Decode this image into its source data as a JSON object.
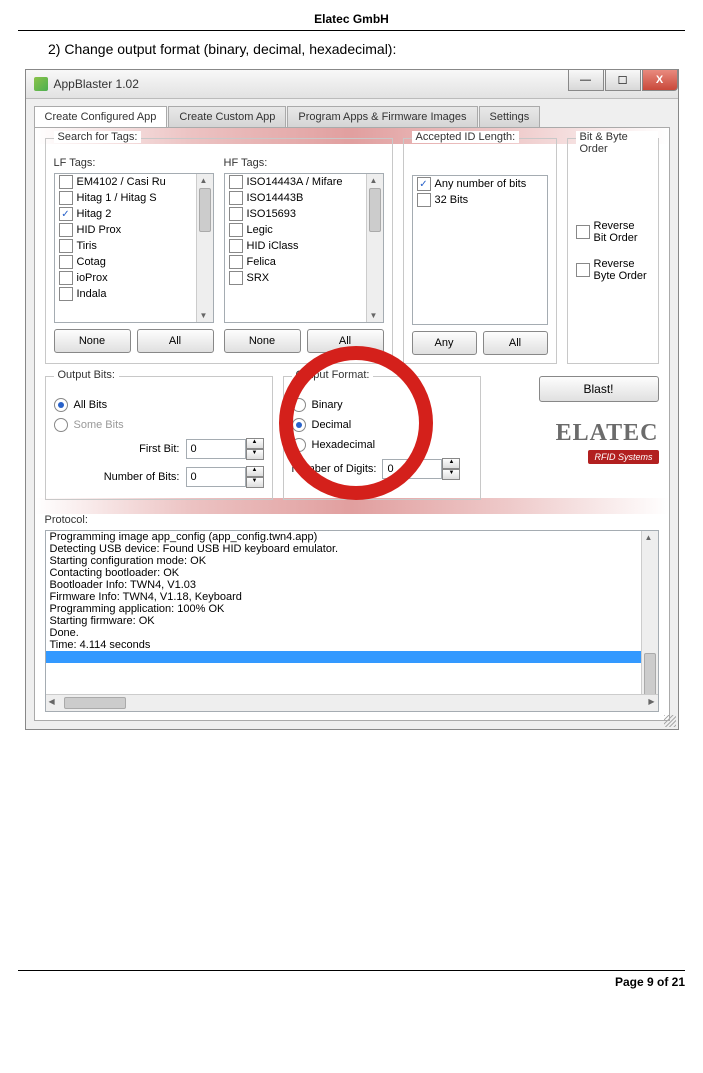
{
  "doc": {
    "header": "Elatec GmbH",
    "step": "2)   Change output format (binary, decimal, hexadecimal):",
    "footer": "Page 9 of 21"
  },
  "window": {
    "title": "AppBlaster 1.02"
  },
  "tabs": [
    "Create Configured App",
    "Create Custom App",
    "Program Apps & Firmware Images",
    "Settings"
  ],
  "groups": {
    "searchTags": "Search for Tags:",
    "lf": "LF Tags:",
    "hf": "HF Tags:",
    "accepted": "Accepted ID Length:",
    "bitByte": "Bit & Byte Order",
    "outBits": "Output Bits:",
    "outFmt": "Output Format:",
    "proto": "Protocol:"
  },
  "lfTags": [
    "EM4102 / Casi Ru",
    "Hitag 1 / Hitag S",
    "Hitag 2",
    "HID Prox",
    "Tiris",
    "Cotag",
    "ioProx",
    "Indala"
  ],
  "lfChecked": [
    false,
    false,
    true,
    false,
    false,
    false,
    false,
    false
  ],
  "hfTags": [
    "ISO14443A / Mifare",
    "ISO14443B",
    "ISO15693",
    "Legic",
    "HID iClass",
    "Felica",
    "SRX"
  ],
  "hfChecked": [
    false,
    false,
    false,
    false,
    false,
    false,
    false
  ],
  "accepted": [
    "Any number of bits",
    "32 Bits"
  ],
  "acceptedChecked": [
    true,
    false
  ],
  "bitByte": {
    "reverseBit": "Reverse Bit Order",
    "reverseByte": "Reverse Byte Order"
  },
  "buttons": {
    "none": "None",
    "all": "All",
    "any": "Any",
    "blast": "Blast!"
  },
  "outputBits": {
    "all": "All Bits",
    "some": "Some Bits",
    "first": "First Bit:",
    "num": "Number of Bits:",
    "firstVal": "0",
    "numVal": "0"
  },
  "outputFmt": {
    "binary": "Binary",
    "decimal": "Decimal",
    "hex": "Hexadecimal",
    "digits": "Number of Digits:",
    "digitsVal": "0"
  },
  "brand": {
    "name": "ELATEC",
    "sub": "RFID Systems"
  },
  "protocol": [
    "Programming image app_config (app_config.twn4.app)",
    "Detecting USB device: Found USB HID keyboard emulator.",
    "Starting configuration mode: OK",
    "Contacting bootloader: OK",
    "Bootloader Info: TWN4, V1.03",
    "Firmware Info: TWN4, V1.18, Keyboard",
    "Programming application: 100% OK",
    "Starting firmware: OK",
    "Done.",
    "Time: 4.114 seconds"
  ]
}
